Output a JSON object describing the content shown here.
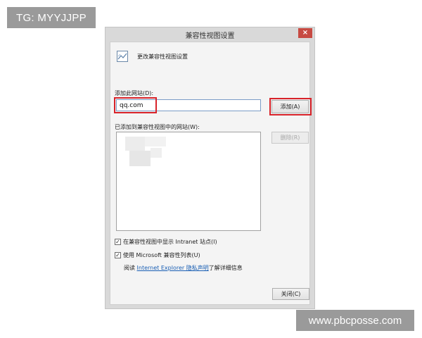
{
  "watermarks": {
    "top_left": "TG: MYYJJPP",
    "bottom_right": "www.pbcposse.com"
  },
  "dialog": {
    "title": "兼容性视图设置",
    "close_glyph": "×",
    "header_text": "更改兼容性视图设置",
    "add_label": "添加此网站(D):",
    "site_input_value": "qq.com",
    "add_button": "添加(A)",
    "list_label": "已添加到兼容性视图中的网站(W):",
    "remove_button": "删除(R)",
    "checkbox_intranet": {
      "label": "在兼容性视图中显示 Intranet 站点(I)",
      "checked": true,
      "mark": "✓"
    },
    "checkbox_mslist": {
      "label": "使用 Microsoft 兼容性列表(U)",
      "checked": true,
      "mark": "✓"
    },
    "privacy": {
      "prefix": "阅读 ",
      "link": "Internet Explorer 隐私声明",
      "suffix": "了解详细信息"
    },
    "close_button": "关闭(C)"
  },
  "colors": {
    "highlight": "#d8232a",
    "link": "#1a5fb4",
    "close_button_bg": "#c74a42"
  }
}
